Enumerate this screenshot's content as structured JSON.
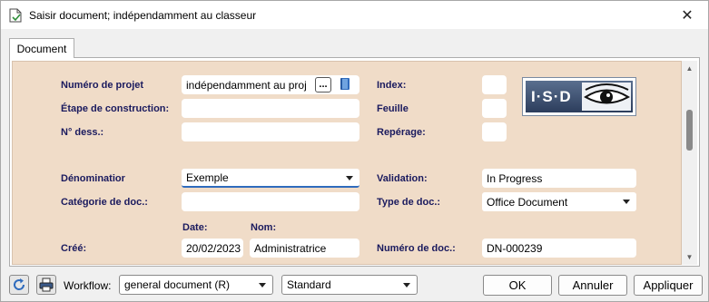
{
  "window": {
    "title": "Saisir document; indépendamment au classeur",
    "close_glyph": "✕"
  },
  "tabs": [
    {
      "label": "Document"
    }
  ],
  "form": {
    "project_number": {
      "label": "Numéro de projet",
      "value": "indépendamment au proj",
      "browse_label": "..."
    },
    "construction_stage": {
      "label": "Étape de construction:",
      "value": ""
    },
    "drawing_number": {
      "label": "N° dess.:",
      "value": ""
    },
    "designation": {
      "label": "Dénominatior",
      "value": "Exemple"
    },
    "doc_category": {
      "label": "Catégorie de doc.:",
      "value": ""
    },
    "created": {
      "label": "Créé:",
      "date_label": "Date:",
      "name_label": "Nom:",
      "date_value": "20/02/2023",
      "name_value": "Administratrice"
    },
    "index": {
      "label": "Index:",
      "value": ""
    },
    "sheet": {
      "label": "Feuille",
      "value": ""
    },
    "reference": {
      "label": "Repérage:",
      "value": ""
    },
    "validation": {
      "label": "Validation:",
      "value": "In Progress"
    },
    "doc_type": {
      "label": "Type de doc.:",
      "value": "Office Document"
    },
    "doc_number": {
      "label": "Numéro de doc.:",
      "value": "DN-000239"
    }
  },
  "logo": {
    "text": "I·S·D"
  },
  "footer": {
    "workflow_label": "Workflow:",
    "workflow_value": "general document (R)",
    "template_value": "Standard",
    "ok_label": "OK",
    "cancel_label": "Annuler",
    "apply_label": "Appliquer"
  },
  "colors": {
    "panel_bg": "#f0dcc8",
    "label": "#1a1a5e",
    "focus": "#2f6bbd"
  }
}
